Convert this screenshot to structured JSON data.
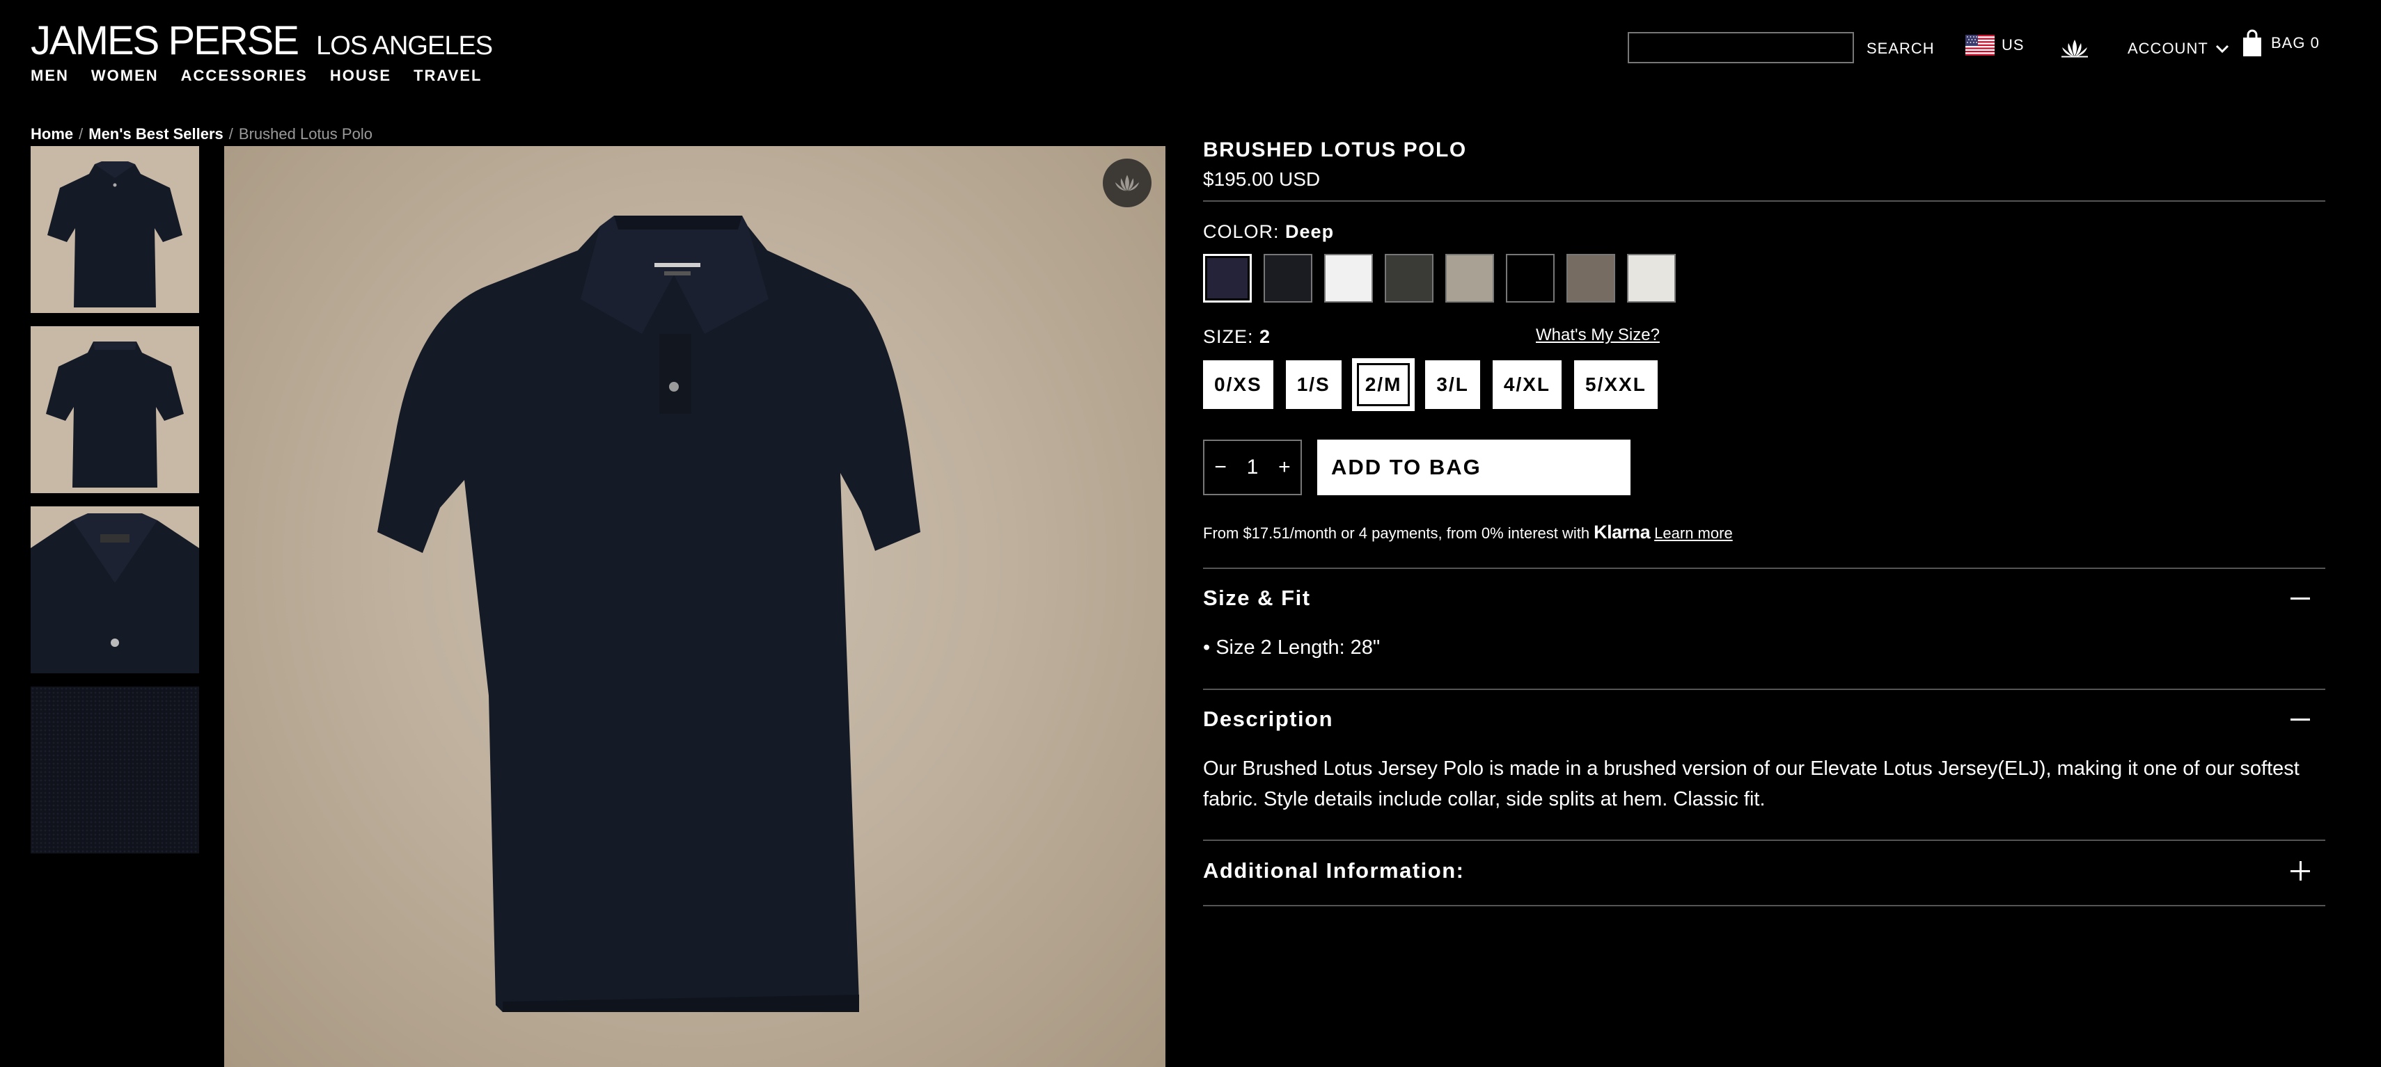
{
  "brand": {
    "name": "JAMES PERSE",
    "location": "LOS ANGELES"
  },
  "nav": [
    "MEN",
    "WOMEN",
    "ACCESSORIES",
    "HOUSE",
    "TRAVEL"
  ],
  "header": {
    "search_value": "",
    "search_label": "SEARCH",
    "region": "US",
    "account": "ACCOUNT",
    "bag": "BAG 0"
  },
  "breadcrumb": {
    "home": "Home",
    "category": "Men's Best Sellers",
    "current": "Brushed Lotus Polo"
  },
  "product": {
    "title": "BRUSHED LOTUS POLO",
    "price": "$195.00 USD",
    "color_label": "COLOR:",
    "color_value": "Deep",
    "swatches": [
      {
        "color": "#24233a",
        "selected": true
      },
      {
        "color": "#1a1c21",
        "selected": false
      },
      {
        "color": "#f1f1f1",
        "selected": false
      },
      {
        "color": "#3a3b37",
        "selected": false
      },
      {
        "color": "#a8a194",
        "selected": false
      },
      {
        "color": "#000000",
        "selected": false
      },
      {
        "color": "#776c62",
        "selected": false
      },
      {
        "color": "#e7e5df",
        "selected": false
      }
    ],
    "size_label": "SIZE:",
    "size_value": "2",
    "size_guide": "What's My Size?",
    "sizes": [
      {
        "label": "0/XS",
        "selected": false
      },
      {
        "label": "1/S",
        "selected": false
      },
      {
        "label": "2/M",
        "selected": true
      },
      {
        "label": "3/L",
        "selected": false
      },
      {
        "label": "4/XL",
        "selected": false
      },
      {
        "label": "5/XXL",
        "selected": false
      }
    ],
    "quantity": "1",
    "qty_minus": "−",
    "qty_plus": "+",
    "add_to_bag": "ADD TO BAG",
    "klarna_text": "From $17.51/month or 4 payments, from 0% interest with",
    "klarna_brand": "Klarna",
    "klarna_link": "Learn more"
  },
  "accordions": {
    "size_fit": {
      "title": "Size & Fit",
      "body": "• Size 2 Length: 28\""
    },
    "description": {
      "title": "Description",
      "body": "Our Brushed Lotus Jersey Polo is made in a brushed version of our Elevate Lotus Jersey(ELJ), making it one of our softest fabric. Style details include collar, side splits at hem. Classic fit."
    },
    "additional": {
      "title": "Additional Information:"
    }
  },
  "colors": {
    "shirt": "#151a27",
    "backdrop": "#c3b6a3",
    "divider": "#555555"
  },
  "icons": {
    "flag": "us-flag-icon",
    "lotus": "lotus-icon",
    "chevron": "chevron-down-icon",
    "bag": "shopping-bag-icon"
  }
}
